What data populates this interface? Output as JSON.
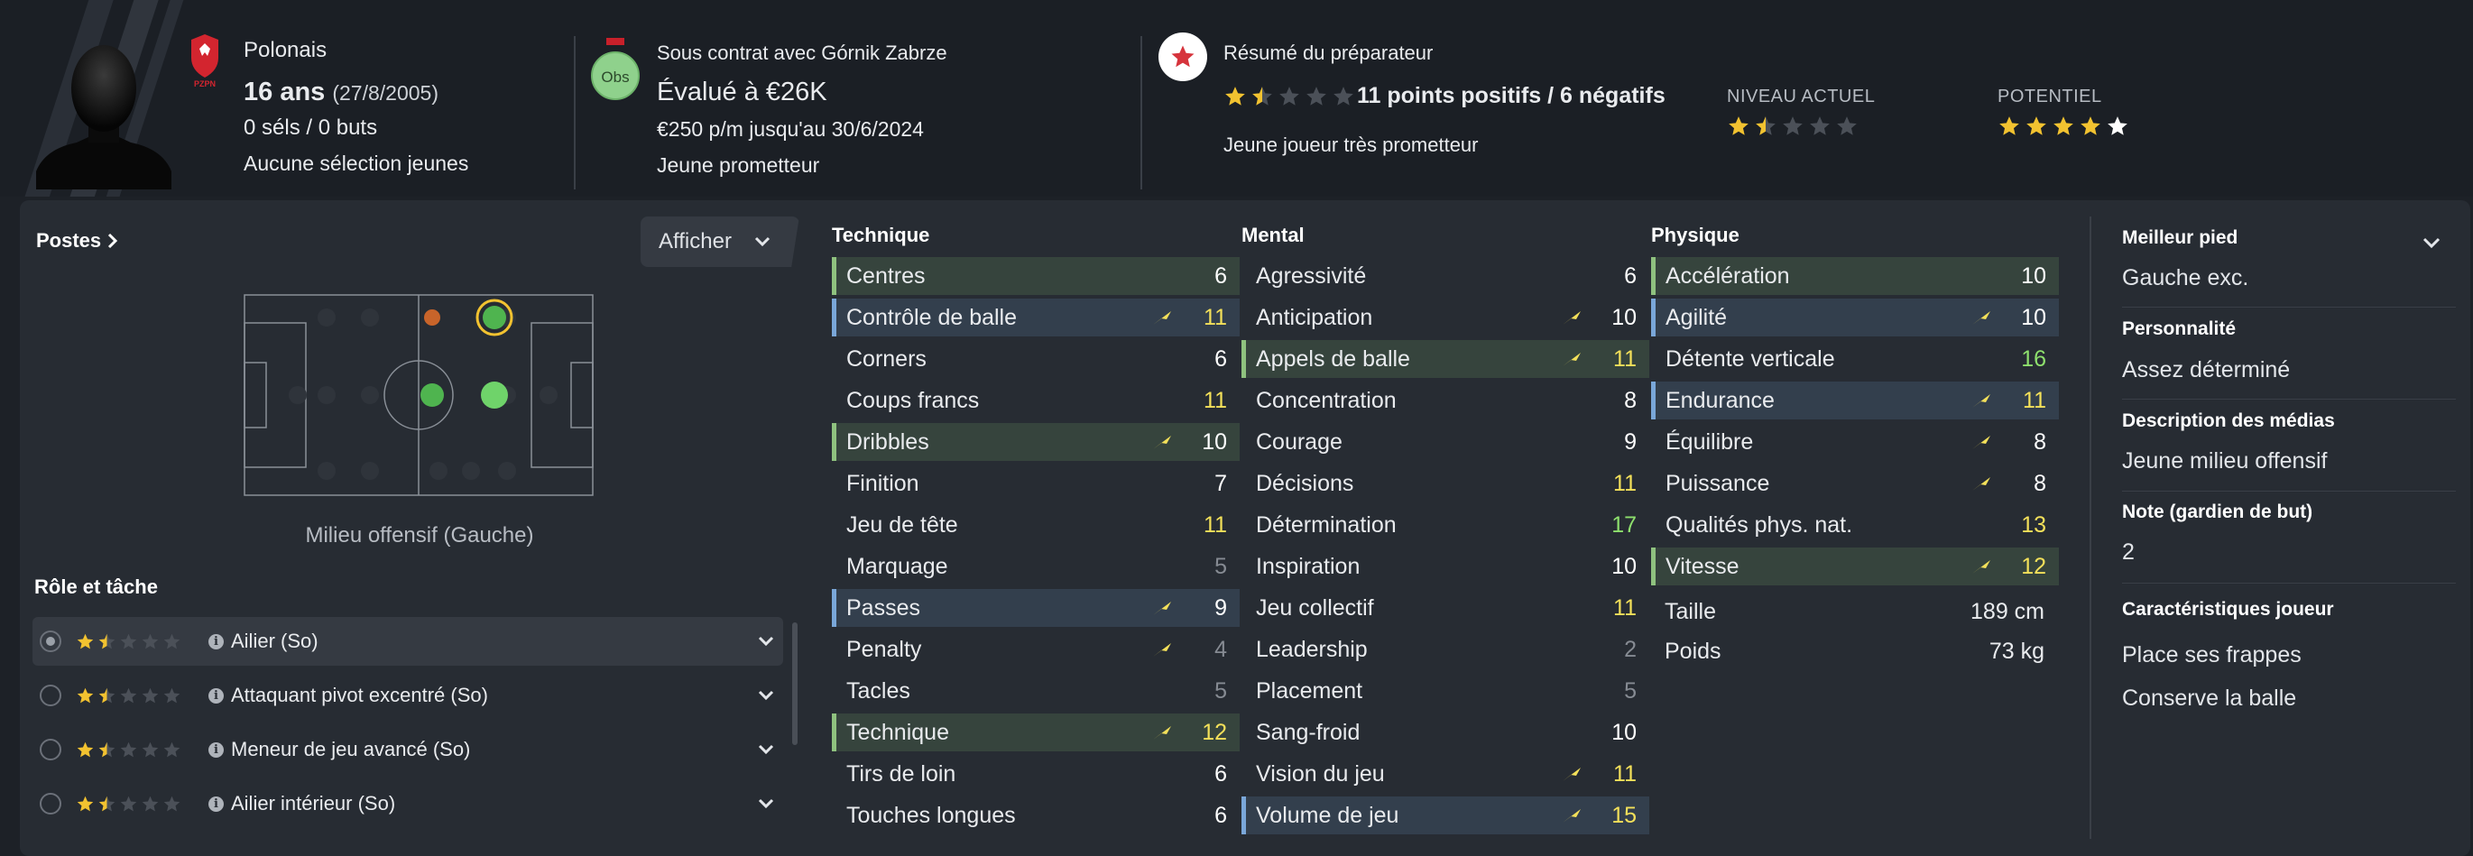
{
  "header": {
    "nationality": "Polonais",
    "age": "16 ans",
    "birth": "(27/8/2005)",
    "caps": "0 séls / 0 buts",
    "youth": "Aucune sélection jeunes",
    "flag_text": "PZPN",
    "contract": "Sous contrat avec Górnik Zabrze",
    "value": "Évalué à €26K",
    "wage": "€250 p/m jusqu'au 30/6/2024",
    "status": "Jeune prometteur",
    "badge_label": "Obs",
    "scout_title": "Résumé du préparateur",
    "scout_points": "11 points positifs / 6 négatifs",
    "scout_summary": "Jeune joueur très prometteur",
    "scout_stars": 1.5,
    "current_label": "NIVEAU ACTUEL",
    "current_stars": 1.5,
    "potential_label": "POTENTIEL",
    "potential_stars": 5,
    "colors": {
      "star_gold": "#f2c230",
      "star_grey": "#4b5058",
      "scout_red": "#d6343c"
    }
  },
  "positions": {
    "title": "Postes",
    "show_button": "Afficher",
    "caption": "Milieu offensif (Gauche)"
  },
  "roles": {
    "title": "Rôle et tâche",
    "items": [
      {
        "name": "Ailier (So)",
        "stars": 1.5,
        "selected": true
      },
      {
        "name": "Attaquant pivot excentré (So)",
        "stars": 1.5,
        "selected": false
      },
      {
        "name": "Meneur de jeu avancé (So)",
        "stars": 1.5,
        "selected": false
      },
      {
        "name": "Ailier intérieur (So)",
        "stars": 1.5,
        "selected": false
      }
    ]
  },
  "attributes": {
    "technique": {
      "title": "Technique",
      "items": [
        {
          "name": "Centres",
          "value": "6",
          "hl": "green",
          "arrow": false,
          "color": "white"
        },
        {
          "name": "Contrôle de balle",
          "value": "11",
          "hl": "blue",
          "arrow": true,
          "color": "yellow"
        },
        {
          "name": "Corners",
          "value": "6",
          "hl": "",
          "arrow": false,
          "color": "white"
        },
        {
          "name": "Coups francs",
          "value": "11",
          "hl": "",
          "arrow": false,
          "color": "yellow"
        },
        {
          "name": "Dribbles",
          "value": "10",
          "hl": "green",
          "arrow": true,
          "color": "white"
        },
        {
          "name": "Finition",
          "value": "7",
          "hl": "",
          "arrow": false,
          "color": "white"
        },
        {
          "name": "Jeu de tête",
          "value": "11",
          "hl": "",
          "arrow": false,
          "color": "yellow"
        },
        {
          "name": "Marquage",
          "value": "5",
          "hl": "",
          "arrow": false,
          "color": "grey"
        },
        {
          "name": "Passes",
          "value": "9",
          "hl": "blue",
          "arrow": true,
          "color": "white"
        },
        {
          "name": "Penalty",
          "value": "4",
          "hl": "",
          "arrow": true,
          "color": "grey"
        },
        {
          "name": "Tacles",
          "value": "5",
          "hl": "",
          "arrow": false,
          "color": "grey"
        },
        {
          "name": "Technique",
          "value": "12",
          "hl": "green",
          "arrow": true,
          "color": "yellow"
        },
        {
          "name": "Tirs de loin",
          "value": "6",
          "hl": "",
          "arrow": false,
          "color": "white"
        },
        {
          "name": "Touches longues",
          "value": "6",
          "hl": "",
          "arrow": false,
          "color": "white"
        }
      ]
    },
    "mental": {
      "title": "Mental",
      "items": [
        {
          "name": "Agressivité",
          "value": "6",
          "hl": "",
          "arrow": false,
          "color": "white"
        },
        {
          "name": "Anticipation",
          "value": "10",
          "hl": "",
          "arrow": true,
          "color": "white"
        },
        {
          "name": "Appels de balle",
          "value": "11",
          "hl": "green",
          "arrow": true,
          "color": "yellow"
        },
        {
          "name": "Concentration",
          "value": "8",
          "hl": "",
          "arrow": false,
          "color": "white"
        },
        {
          "name": "Courage",
          "value": "9",
          "hl": "",
          "arrow": false,
          "color": "white"
        },
        {
          "name": "Décisions",
          "value": "11",
          "hl": "",
          "arrow": false,
          "color": "yellow"
        },
        {
          "name": "Détermination",
          "value": "17",
          "hl": "",
          "arrow": false,
          "color": "green"
        },
        {
          "name": "Inspiration",
          "value": "10",
          "hl": "",
          "arrow": false,
          "color": "white"
        },
        {
          "name": "Jeu collectif",
          "value": "11",
          "hl": "",
          "arrow": false,
          "color": "yellow"
        },
        {
          "name": "Leadership",
          "value": "2",
          "hl": "",
          "arrow": false,
          "color": "grey"
        },
        {
          "name": "Placement",
          "value": "5",
          "hl": "",
          "arrow": false,
          "color": "grey"
        },
        {
          "name": "Sang-froid",
          "value": "10",
          "hl": "",
          "arrow": false,
          "color": "white"
        },
        {
          "name": "Vision du jeu",
          "value": "11",
          "hl": "",
          "arrow": true,
          "color": "yellow"
        },
        {
          "name": "Volume de jeu",
          "value": "15",
          "hl": "blue",
          "arrow": true,
          "color": "yellow"
        }
      ]
    },
    "physique": {
      "title": "Physique",
      "items": [
        {
          "name": "Accélération",
          "value": "10",
          "hl": "green",
          "arrow": false,
          "color": "white"
        },
        {
          "name": "Agilité",
          "value": "10",
          "hl": "blue",
          "arrow": true,
          "color": "white"
        },
        {
          "name": "Détente verticale",
          "value": "16",
          "hl": "",
          "arrow": false,
          "color": "green"
        },
        {
          "name": "Endurance",
          "value": "11",
          "hl": "blue",
          "arrow": true,
          "color": "yellow"
        },
        {
          "name": "Équilibre",
          "value": "8",
          "hl": "",
          "arrow": true,
          "color": "white"
        },
        {
          "name": "Puissance",
          "value": "8",
          "hl": "",
          "arrow": true,
          "color": "white"
        },
        {
          "name": "Qualités phys. nat.",
          "value": "13",
          "hl": "",
          "arrow": false,
          "color": "yellow"
        },
        {
          "name": "Vitesse",
          "value": "12",
          "hl": "green",
          "arrow": true,
          "color": "yellow"
        }
      ],
      "height_label": "Taille",
      "height_value": "189 cm",
      "weight_label": "Poids",
      "weight_value": "73 kg"
    }
  },
  "info": {
    "foot_label": "Meilleur pied",
    "foot_value": "Gauche exc.",
    "personality_label": "Personnalité",
    "personality_value": "Assez déterminé",
    "media_label": "Description des médias",
    "media_value": "Jeune milieu offensif",
    "gk_label": "Note (gardien de but)",
    "gk_value": "2",
    "traits_label": "Caractéristiques joueur",
    "traits": [
      "Place ses frappes",
      "Conserve la balle"
    ]
  }
}
